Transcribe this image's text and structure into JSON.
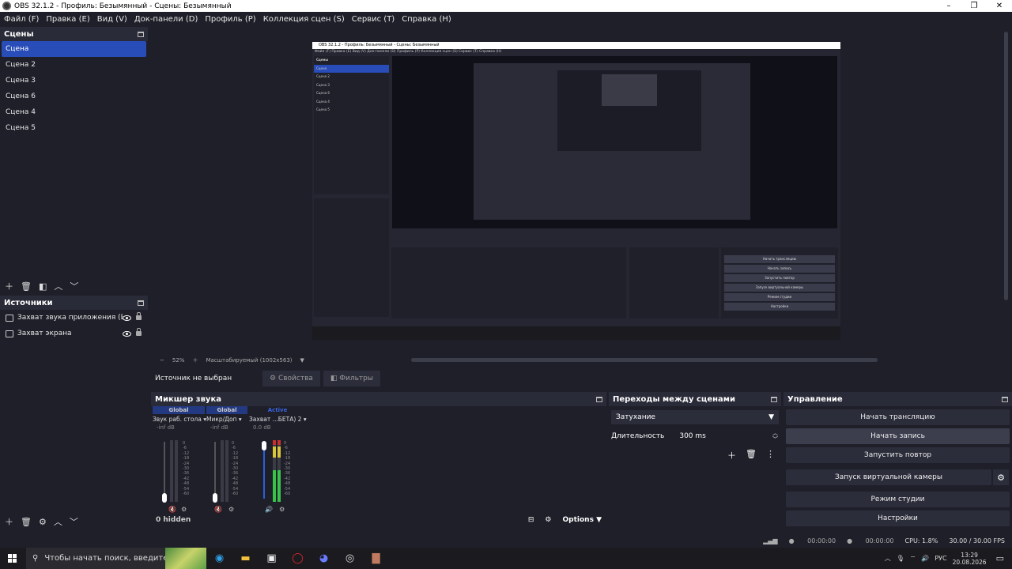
{
  "window": {
    "title": "OBS 32.1.2 - Профиль: Безымянный - Сцены: Безымянный",
    "minimize": "–",
    "maximize": "❐",
    "close": "✕"
  },
  "menu": [
    "Файл (F)",
    "Правка (E)",
    "Вид (V)",
    "Док-панели (D)",
    "Профиль (P)",
    "Коллекция сцен (S)",
    "Сервис (T)",
    "Справка (H)"
  ],
  "scenes": {
    "title": "Сцены",
    "items": [
      "Сцена",
      "Сцена 2",
      "Сцена 3",
      "Сцена 6",
      "Сцена 4",
      "Сцена 5"
    ],
    "selected": 0
  },
  "sources": {
    "title": "Источники",
    "items": [
      "Захват звука приложения (БЕТА)",
      "Захват экрана"
    ]
  },
  "preview": {
    "zoom": "52%",
    "scale_mode": "Масштабируемый (1002x563)",
    "nested_title": "OBS 32.1.2 - Профиль: Безымянный - Сцены: Безымянный",
    "nested_menu": "Файл (F)   Правка (E)   Вид (V)   Док-панели (D)   Профиль (P)   Коллекция сцен (S)   Сервис (T)   Справка (H)",
    "nested_scenes": [
      "Сцена",
      "Сцена 2",
      "Сцена 3",
      "Сцена 6",
      "Сцена 4",
      "Сцена 5"
    ],
    "nested_controls": [
      "Начать трансляцию",
      "Начать запись",
      "Запустить повтор",
      "Запуск виртуальной камеры",
      "Режим студии",
      "Настройки"
    ]
  },
  "context": {
    "label": "Источник не выбран",
    "properties": "Свойства",
    "filters": "Фильтры"
  },
  "mixer": {
    "title": "Микшер звука",
    "channels": [
      {
        "head": "Global",
        "name": "Звук раб. стола",
        "db": "-inf dB"
      },
      {
        "head": "Global",
        "name": "Микр/Доп",
        "db": "-inf dB"
      },
      {
        "head": "Active",
        "name": "Захват ...БЕТА) 2",
        "db": "0.0 dB"
      }
    ],
    "scale": [
      "0",
      "-6",
      "-12",
      "-18",
      "-24",
      "-30",
      "-36",
      "-42",
      "-48",
      "-54",
      "-60"
    ],
    "hidden": "0 hidden",
    "options": "Options"
  },
  "transitions": {
    "title": "Переходы между сценами",
    "type": "Затухание",
    "duration_label": "Длительность",
    "duration": "300 ms"
  },
  "controls": {
    "title": "Управление",
    "start_stream": "Начать трансляцию",
    "start_record": "Начать запись",
    "replay": "Запустить повтор",
    "virtual_cam": "Запуск виртуальной камеры",
    "studio_mode": "Режим студии",
    "settings": "Настройки"
  },
  "status": {
    "stream_time": "00:00:00",
    "record_time": "00:00:00",
    "cpu": "CPU: 1.8%",
    "fps": "30.00 / 30.00 FPS"
  },
  "taskbar": {
    "search_placeholder": "Чтобы начать поиск, введите",
    "lang": "РУС",
    "time": "13:29",
    "date": "20.08.2026"
  }
}
